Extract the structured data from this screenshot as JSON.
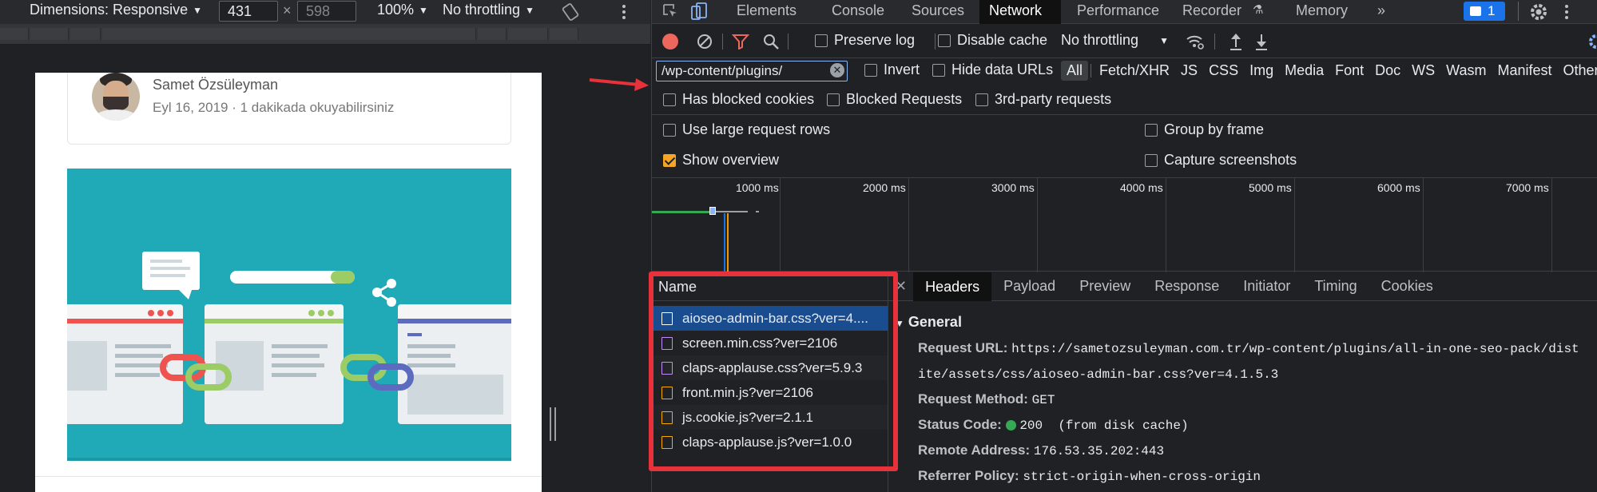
{
  "device_toolbar": {
    "dimensions_label": "Dimensions: Responsive",
    "width_value": "431",
    "times": "×",
    "height_value": "598",
    "zoom": "100%",
    "throttling": "No throttling"
  },
  "page": {
    "author": "Samet Özsüleyman",
    "meta": "Eyl 16, 2019 · 1 dakikada okuyabilirsiniz"
  },
  "devtools": {
    "tabs": [
      "Elements",
      "Console",
      "Sources",
      "Network",
      "Performance",
      "Recorder",
      "Memory",
      "»"
    ],
    "active_tab": "Network",
    "issues_count": "1",
    "toolbar": {
      "preserve_log": "Preserve log",
      "disable_cache": "Disable cache",
      "throttling": "No throttling"
    },
    "filter": {
      "value": "/wp-content/plugins/",
      "invert": "Invert",
      "hide_data_urls": "Hide data URLs",
      "types": [
        "All",
        "Fetch/XHR",
        "JS",
        "CSS",
        "Img",
        "Media",
        "Font",
        "Doc",
        "WS",
        "Wasm",
        "Manifest",
        "Other"
      ],
      "has_blocked_cookies": "Has blocked cookies",
      "blocked_requests": "Blocked Requests",
      "third_party": "3rd-party requests"
    },
    "settings": {
      "large_rows": "Use large request rows",
      "group_by_frame": "Group by frame",
      "show_overview": "Show overview",
      "capture_screenshots": "Capture screenshots"
    },
    "overview_ticks": [
      "1000 ms",
      "2000 ms",
      "3000 ms",
      "4000 ms",
      "5000 ms",
      "6000 ms",
      "7000 ms"
    ],
    "requests": {
      "column": "Name",
      "rows": [
        {
          "name": "aioseo-admin-bar.css?ver=4....",
          "type": "css"
        },
        {
          "name": "screen.min.css?ver=2106",
          "type": "css"
        },
        {
          "name": "claps-applause.css?ver=5.9.3",
          "type": "css"
        },
        {
          "name": "front.min.js?ver=2106",
          "type": "js"
        },
        {
          "name": "js.cookie.js?ver=2.1.1",
          "type": "js"
        },
        {
          "name": "claps-applause.js?ver=1.0.0",
          "type": "js"
        }
      ]
    },
    "detail_tabs": [
      "Headers",
      "Payload",
      "Preview",
      "Response",
      "Initiator",
      "Timing",
      "Cookies"
    ],
    "general": {
      "title": "General",
      "request_url_label": "Request URL:",
      "request_url": "https://sametozsuleyman.com.tr/wp-content/plugins/all-in-one-seo-pack/dist",
      "request_url_cont": "ite/assets/css/aioseo-admin-bar.css?ver=4.1.5.3",
      "method_label": "Request Method:",
      "method": "GET",
      "status_label": "Status Code:",
      "status": "200  (from disk cache)",
      "remote_label": "Remote Address:",
      "remote": "176.53.35.202:443",
      "referrer_label": "Referrer Policy:",
      "referrer": "strict-origin-when-cross-origin"
    }
  }
}
